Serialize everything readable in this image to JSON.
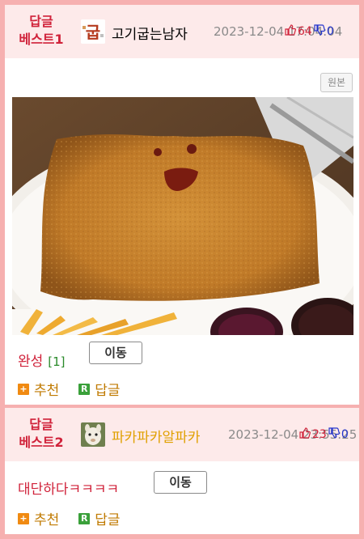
{
  "replies": [
    {
      "badge_line1": "답글",
      "badge_line2": "베스트1",
      "avatar_text": "굽",
      "nickname": "고기굽는남자",
      "nickname_color": "#222222",
      "date": "2023-12-04 17:04:04",
      "up_count": "64",
      "down_count": "0",
      "original_button": "원본",
      "content": "완성",
      "comment_count": "[1]",
      "move_button": "이동",
      "recommend": "추천",
      "reply": "답글"
    },
    {
      "badge_line1": "답글",
      "badge_line2": "베스트2",
      "nickname": "파카파카알파카",
      "nickname_color": "#e0a000",
      "date": "2023-12-04 23:55:25",
      "up_count": "23",
      "down_count": "0",
      "content": "대단하다ㅋㅋㅋㅋ",
      "move_button": "이동",
      "recommend": "추천",
      "reply": "답글"
    }
  ],
  "colors": {
    "frame_border": "#f6b0b0",
    "header_bg": "#fdeaea",
    "badge": "#d0223a",
    "up": "#d0223a",
    "down": "#2233cc",
    "recommend": "#c07a00"
  },
  "icons": [
    "thumbs-up-icon",
    "thumbs-down-icon",
    "plus-icon",
    "reply-r-icon"
  ]
}
